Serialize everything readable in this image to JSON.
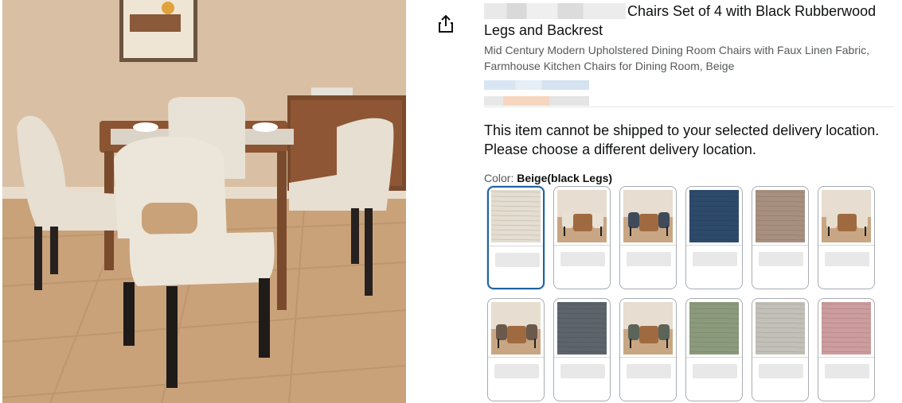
{
  "product": {
    "title_tail": "Chairs Set of 4 with Black Rubberwood Legs and Backrest",
    "subtitle": "Mid Century Modern Upholstered Dining Room Chairs with Faux Linen Fabric, Farmhouse Kitchen Chairs for Dining Room, Beige"
  },
  "delivery": {
    "message": "This item cannot be shipped to your selected delivery location. Please choose a different delivery location."
  },
  "color": {
    "label": "Color:",
    "selected": "Beige(black Legs)"
  },
  "icons": {
    "share": "share-icon"
  },
  "colors": {
    "selected_border": "#2162a1",
    "swatch_border": "#a7acb2",
    "subtle_text": "#565959"
  },
  "swatches": [
    {
      "kind": "texture",
      "color": "#e4ddd0",
      "selected": true
    },
    {
      "kind": "photo",
      "chair": "#e9e1d3"
    },
    {
      "kind": "photo",
      "chair": "#3f4a5a"
    },
    {
      "kind": "texture",
      "color": "#2e4a6b"
    },
    {
      "kind": "texture",
      "color": "#a89080"
    },
    {
      "kind": "photo",
      "chair": "#e6ddcd"
    },
    {
      "kind": "photo",
      "chair": "#6b5a4c"
    },
    {
      "kind": "texture",
      "color": "#5d646b"
    },
    {
      "kind": "photo",
      "chair": "#5c6457"
    },
    {
      "kind": "texture",
      "color": "#8c9a7c"
    },
    {
      "kind": "texture",
      "color": "#c2c0b8"
    },
    {
      "kind": "texture",
      "color": "#cc9c9e"
    }
  ]
}
